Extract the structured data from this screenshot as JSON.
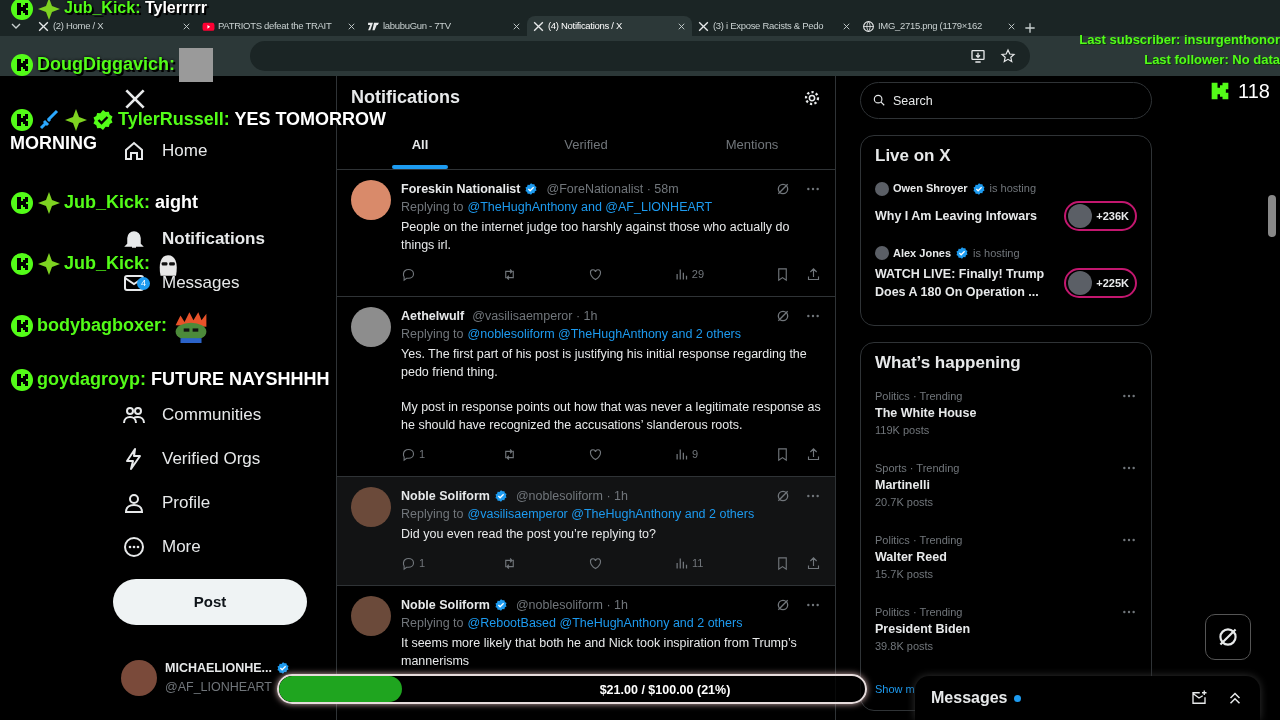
{
  "browser": {
    "tabs": [
      {
        "title": "(2) Home / X",
        "selected": false
      },
      {
        "title": "PATRIOTS defeat the TRAIT",
        "selected": false
      },
      {
        "title": "labubuGun - 7TV",
        "selected": false
      },
      {
        "title": "(4) Notifications / X",
        "selected": true
      },
      {
        "title": "(3) i Expose Racists & Pedo",
        "selected": false
      },
      {
        "title": "IMG_2715.png (1179×162",
        "selected": false
      }
    ]
  },
  "sidebar": {
    "nav": [
      {
        "label": "Home",
        "selected": false
      },
      {
        "label": "Notifications",
        "selected": true
      },
      {
        "label": "Messages",
        "badge": "4",
        "selected": false
      },
      {
        "label": "Communities",
        "selected": false
      },
      {
        "label": "Verified Orgs",
        "selected": false
      },
      {
        "label": "Profile",
        "selected": false
      },
      {
        "label": "More",
        "selected": false
      }
    ],
    "post_button": "Post",
    "account": {
      "name": "MICHAELIONHE...",
      "handle": "@AF_LIONHEART",
      "verified": true
    }
  },
  "notifications": {
    "title": "Notifications",
    "tabs": [
      {
        "label": "All",
        "selected": true
      },
      {
        "label": "Verified",
        "selected": false
      },
      {
        "label": "Mentions",
        "selected": false
      }
    ],
    "posts": [
      {
        "name": "Foreskin Nationalist",
        "verified": true,
        "meta": "@ForeNationalist · 58m",
        "reply_prefix": "Replying to",
        "reply_targets": "@TheHughAnthony and @AF_LIONHEART",
        "paragraphs": [
          "People on the internet judge too harshly against those who actually do things irl."
        ],
        "views": "29",
        "highlighted": false
      },
      {
        "name": "Aethelwulf",
        "verified": false,
        "meta": "@vasilisaemperor · 1h",
        "reply_prefix": "Replying to",
        "reply_targets": "@noblesoliform @TheHughAnthony and 2 others",
        "paragraphs": [
          "Yes. The first part of his post is justifying his initial response regarding the pedo friend thing.",
          "My post in response points out how that was never a legitimate response as he should have recognized the accusations’ slanderous roots."
        ],
        "replies": "1",
        "views": "9",
        "highlighted": false
      },
      {
        "name": "Noble Soliform",
        "verified": true,
        "meta": "@noblesoliform · 1h",
        "reply_prefix": "Replying to",
        "reply_targets": "@vasilisaemperor @TheHughAnthony and 2 others",
        "paragraphs": [
          "Did you even read the post you’re replying to?"
        ],
        "replies": "1",
        "views": "11",
        "highlighted": true
      },
      {
        "name": "Noble Soliform",
        "verified": true,
        "meta": "@noblesoliform · 1h",
        "reply_prefix": "Replying to",
        "reply_targets": "@RebootBased @TheHughAnthony and 2 others",
        "paragraphs": [
          "It seems more likely that both he and Nick took inspiration from Trump’s mannerisms"
        ],
        "highlighted": false
      }
    ]
  },
  "right": {
    "search": {
      "placeholder": "Search"
    },
    "live": {
      "title": "Live on X",
      "items": [
        {
          "host": "Owen Shroyer",
          "verified": true,
          "hosting": "is hosting",
          "title": "Why I Am Leaving Infowars",
          "listeners": "+236K"
        },
        {
          "host": "Alex Jones",
          "verified": true,
          "hosting": "is hosting",
          "title": "WATCH LIVE: Finally! Trump Does A 180 On Operation ...",
          "listeners": "+225K"
        }
      ]
    },
    "trending": {
      "title": "What’s happening",
      "items": [
        {
          "category": "Politics · Trending",
          "topic": "The White House",
          "posts": "119K posts"
        },
        {
          "category": "Sports · Trending",
          "topic": "Martinelli",
          "posts": "20.7K posts"
        },
        {
          "category": "Politics · Trending",
          "topic": "Walter Reed",
          "posts": "15.7K posts"
        },
        {
          "category": "Politics · Trending",
          "topic": "President Biden",
          "posts": "39.8K posts"
        }
      ],
      "show_more": "Show m"
    },
    "messages_drawer": {
      "title": "Messages",
      "unread": true
    }
  },
  "stream_overlay": {
    "chat": [
      {
        "user": "Jub_Kick:",
        "badges": [
          {
            "kind": "kick"
          },
          {
            "kind": "gem"
          }
        ],
        "message_lines": [
          "Tylerrrrr"
        ]
      },
      {
        "user": "DougDiggavich:",
        "badges": [
          {
            "kind": "kick"
          }
        ],
        "emote": {
          "kind": "photo"
        }
      },
      {
        "user": "TylerRussell:",
        "badges": [
          {
            "kind": "kick"
          },
          {
            "kind": "sword"
          },
          {
            "kind": "gem"
          },
          {
            "kind": "check"
          }
        ],
        "message_lines": [
          "YES TOMORROW",
          "MORNING"
        ]
      },
      {
        "user": "Jub_Kick:",
        "badges": [
          {
            "kind": "kick"
          },
          {
            "kind": "gem"
          }
        ],
        "message_lines": [
          "aight"
        ]
      },
      {
        "user": "Jub_Kick:",
        "badges": [
          {
            "kind": "kick"
          },
          {
            "kind": "gem"
          }
        ],
        "emote": {
          "kind": "sunglasses"
        }
      },
      {
        "user": "bodybagboxer:",
        "badges": [
          {
            "kind": "kick"
          }
        ],
        "emote": {
          "kind": "frog"
        }
      },
      {
        "user": "goydagroyp:",
        "badges": [
          {
            "kind": "kick"
          }
        ],
        "message_lines": [
          "FUTURE NAYSHHHH"
        ]
      }
    ],
    "last_subscriber": "Last subscriber: insurgenthonor",
    "last_follower": "Last follower: No data",
    "viewers": "118",
    "donation_goal": {
      "label": "$21.00 / $100.00 (21%)",
      "level": 0.21
    }
  }
}
